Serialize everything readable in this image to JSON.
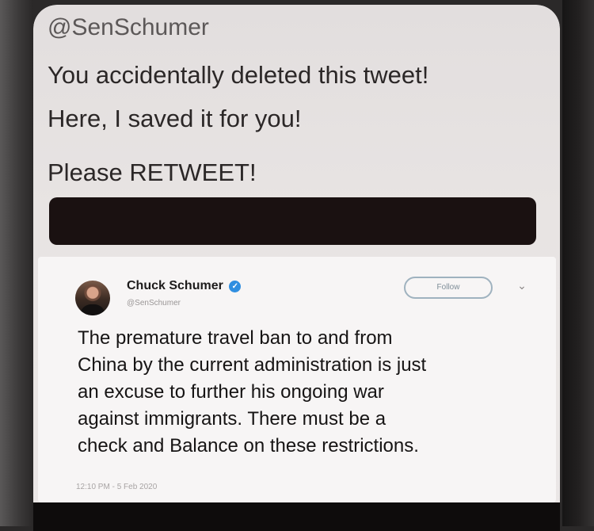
{
  "message": {
    "handle": "@SenSchumer",
    "line1": "You accidentally deleted this tweet!",
    "line2": "Here, I saved it for you!",
    "line3": "Please RETWEET!"
  },
  "tweet": {
    "author_name": "Chuck Schumer",
    "verified_glyph": "✓",
    "username": "@SenSchumer",
    "follow_label": "Follow",
    "menu_glyph": "⌄",
    "body_lines": [
      "The premature travel ban to and from",
      "China by the current administration is just",
      "an excuse to further his ongoing war",
      "against immigrants. There must be a",
      "check and Balance on these restrictions."
    ],
    "timestamp": "12:10 PM - 5 Feb 2020"
  },
  "icons": {
    "verified": "verified-badge-icon",
    "menu": "chevron-down-icon"
  },
  "colors": {
    "verified_blue": "#2f8ee0",
    "redaction_bar": "#1a1111"
  }
}
